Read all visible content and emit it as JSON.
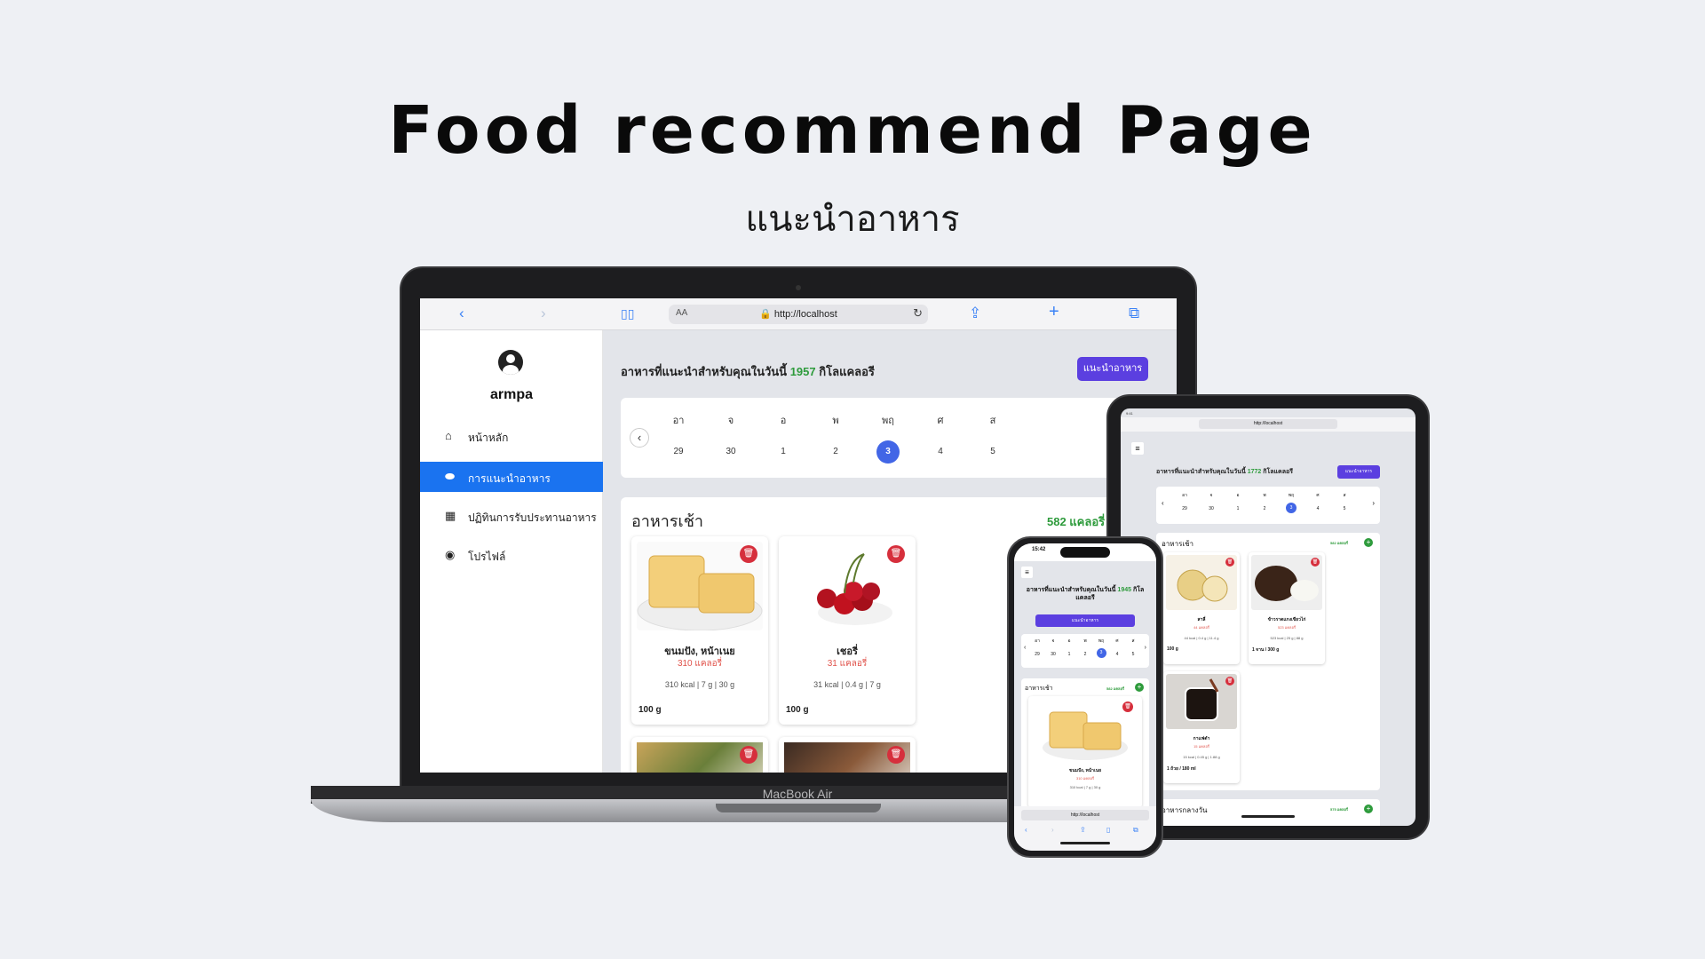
{
  "hero": {
    "title": "Food recommend Page",
    "subtitle": "แนะนำอาหาร"
  },
  "device_label": "MacBook Air",
  "browser": {
    "url": "http://localhost",
    "aa": "AA"
  },
  "sidebar": {
    "username": "armpa",
    "items": [
      {
        "label": "หน้าหลัก",
        "icon": "home-icon",
        "active": false
      },
      {
        "label": "การแนะนำอาหาร",
        "icon": "food-icon",
        "active": true
      },
      {
        "label": "ปฏิทินการรับประทานอาหาร",
        "icon": "calendar-icon",
        "active": false
      },
      {
        "label": "โปรไฟล์",
        "icon": "user-circle-icon",
        "active": false
      }
    ]
  },
  "recommend": {
    "prefix": "อาหารที่แนะนำสำหรับคุณในวันนี้",
    "calories": "1957",
    "suffix": "กิโลแคลอรี",
    "button": "แนะนำอาหาร"
  },
  "calendar": {
    "days": [
      {
        "dow": "อา",
        "date": "29"
      },
      {
        "dow": "จ",
        "date": "30"
      },
      {
        "dow": "อ",
        "date": "1"
      },
      {
        "dow": "พ",
        "date": "2"
      },
      {
        "dow": "พฤ",
        "date": "3",
        "selected": true
      },
      {
        "dow": "ศ",
        "date": "4"
      },
      {
        "dow": "ส",
        "date": "5"
      }
    ]
  },
  "breakfast": {
    "title": "อาหารเช้า",
    "kcal": "582 แคลอรี่",
    "foods": [
      {
        "name": "ขนมปัง, หน้าเนย",
        "kcal": "310 แคลอรี่",
        "macros": "310 kcal | 7 g | 30 g",
        "amount": "100 g"
      },
      {
        "name": "เชอรี่",
        "kcal": "31 แคลอรี่",
        "macros": "31 kcal | 0.4 g | 7 g",
        "amount": "100 g"
      }
    ]
  },
  "tablet": {
    "status": "9:41",
    "url": "http://localhost",
    "rec_prefix": "อาหารที่แนะนำสำหรับคุณในวันนี้",
    "rec_calories": "1772",
    "rec_suffix": "กิโลแคลอรี",
    "button": "แนะนำอาหาร",
    "meal_title": "อาหารเช้า",
    "meal_kcal": "582 แคลอรี่",
    "foods": [
      {
        "name": "สาลี่",
        "kcal": "44 แคลอรี่",
        "macros": "44 kcal | 0.4 g | 11.4 g",
        "amount": "100 g"
      },
      {
        "name": "ข้าวราดแกงเขียวไก่",
        "kcal": "523 แคลอรี่",
        "macros": "523 kcal | 25 g | 88 g",
        "amount": "1 จาน / 300 g"
      },
      {
        "name": "กาแฟดำ",
        "kcal": "15 แคลอรี่",
        "macros": "15 kcal | 0.45 g | 1.88 g",
        "amount": "1 ถ้วย / 180 ml"
      }
    ],
    "lunch_title": "อาหารกลางวัน",
    "lunch_kcal": "575 แคลอรี่"
  },
  "phone": {
    "time": "15:42",
    "url": "http://localhost",
    "rec_prefix": "อาหารที่แนะนำสำหรับคุณในวันนี้",
    "rec_calories": "1945",
    "rec_suffix": "กิโลแคลอรี",
    "button": "แนะนำอาหาร",
    "meal_title": "อาหารเช้า",
    "meal_kcal": "582 แคลอรี่",
    "food": {
      "name": "ขนมปัง, หน้าเนย",
      "kcal": "310 แคลอรี่",
      "macros": "310 kcal | 7 g | 30 g"
    }
  },
  "colors": {
    "primary": "#1a73f0",
    "accent": "#5b3fe0",
    "green": "#2e9b3c",
    "danger": "#d62f3c",
    "selected_day": "#4266e6"
  }
}
